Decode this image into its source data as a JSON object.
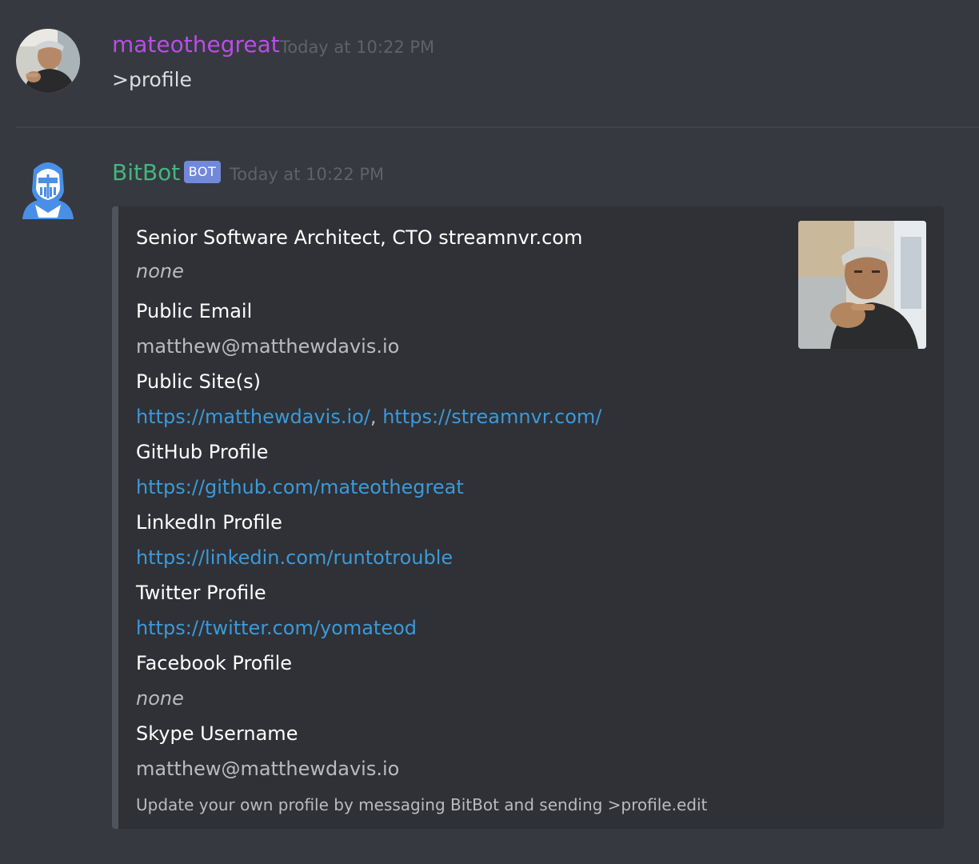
{
  "messages": [
    {
      "author": "mateothegreat",
      "author_color": "#b84ee6",
      "timestamp": "Today at 10:22 PM",
      "text": ">profile",
      "avatar_icon": "user-photo-avatar"
    },
    {
      "author": "BitBot",
      "author_color": "#43b581",
      "tag": "BOT",
      "timestamp": "Today at 10:22 PM",
      "avatar_icon": "knight-helmet-avatar"
    }
  ],
  "embed": {
    "title": "Senior Software Architect, CTO streamnvr.com",
    "description": "none",
    "fields": [
      {
        "name": "Public Email",
        "value": "matthew@matthewdavis.io"
      },
      {
        "name": "Public Site(s)",
        "links": [
          "https://matthewdavis.io/",
          "https://streamnvr.com/"
        ],
        "separator": ", "
      },
      {
        "name": "GitHub Profile",
        "link": "https://github.com/mateothegreat"
      },
      {
        "name": "LinkedIn Profile",
        "link": "https://linkedin.com/runtotrouble"
      },
      {
        "name": "Twitter Profile",
        "link": "https://twitter.com/yomateod"
      },
      {
        "name": "Facebook Profile",
        "value": "none"
      },
      {
        "name": "Skype Username",
        "value": "matthew@matthewdavis.io"
      }
    ],
    "footer": "Update your own profile by messaging BitBot and sending >profile.edit",
    "thumbnail_icon": "profile-photo-thumbnail"
  },
  "colors": {
    "background": "#36393f",
    "embed_background": "#2f3136",
    "embed_border": "#4f545c",
    "link": "#3c99d8",
    "bot_tag": "#7289da"
  }
}
